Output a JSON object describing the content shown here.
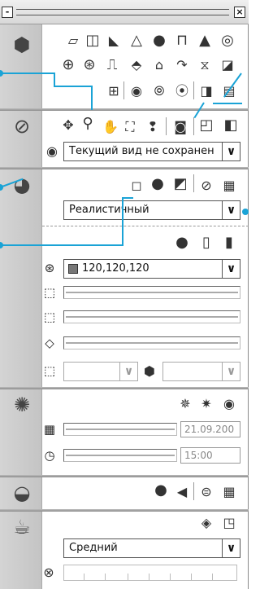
{
  "titlebar": {
    "minimize_label": "-",
    "close_label": "×"
  },
  "sections": {
    "view_section": {
      "named_view_combo": {
        "value": "Текущий вид не сохранен"
      }
    },
    "visual_style_section": {
      "visual_style_combo": {
        "value": "Реалистичный"
      }
    },
    "lighting_section": {
      "color_field": {
        "value": "120,120,120"
      }
    },
    "sun_section": {
      "date_field": {
        "value": "21.09.200"
      },
      "time_field": {
        "value": "15:00"
      }
    },
    "render_section": {
      "quality_combo": {
        "value": "Средний"
      }
    }
  },
  "colors": {
    "accent_callout": "#1aa3d6",
    "swatch": "#787878"
  }
}
